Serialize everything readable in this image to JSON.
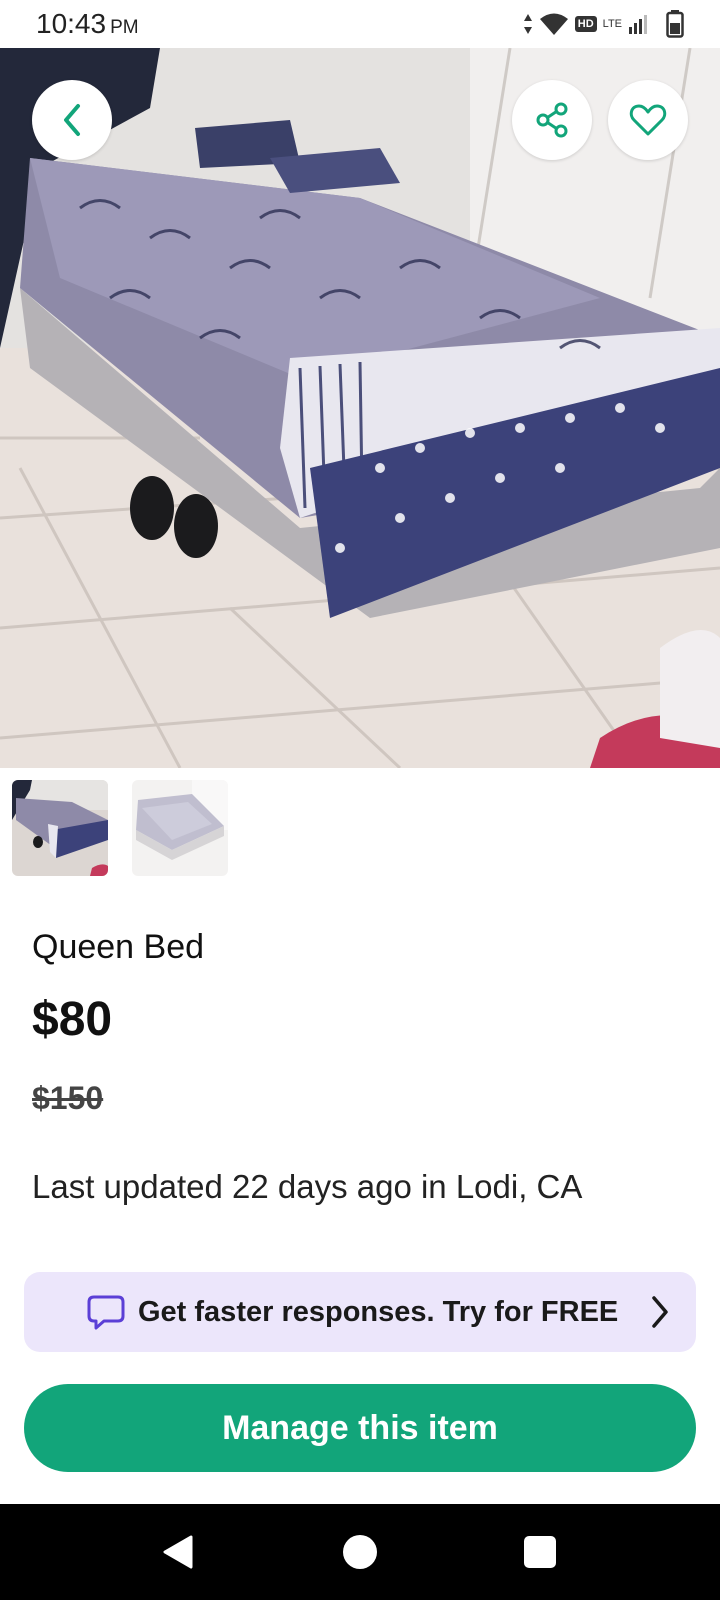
{
  "status_bar": {
    "time": "10:43",
    "ampm": "PM",
    "hd_label": "HD",
    "network_label": "LTE"
  },
  "hero_image": {
    "icon": "bed-photo"
  },
  "top_actions": {
    "back_icon": "chevron-left-icon",
    "share_icon": "share-icon",
    "favorite_icon": "heart-icon"
  },
  "thumbnails": [
    {
      "name": "bed-photo-1"
    },
    {
      "name": "bed-photo-2"
    }
  ],
  "listing": {
    "title": "Queen Bed",
    "price": "$80",
    "original_price": "$150",
    "updated": "Last updated 22 days ago in Lodi, CA"
  },
  "promo": {
    "text": "Get faster responses. Try for FREE",
    "icon": "chat-bubble-icon"
  },
  "primary_action": {
    "label": "Manage this item"
  },
  "colors": {
    "accent": "#12a57a",
    "promo_bg": "#ece6fb",
    "promo_icon": "#5b3fd6"
  }
}
